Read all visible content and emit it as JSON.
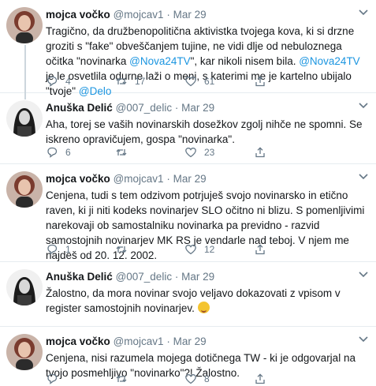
{
  "tweets": [
    {
      "name": "mojca vočko",
      "handle": "@mojcav1",
      "dot": "·",
      "date": "Mar 29",
      "text_parts": [
        "Tragično, da družbenopolitična aktivistka tvojega kova, ki si drzne groziti s \"fake\" obveščanjem tujine, ne vidi dlje od nebuloznega očitka \"novinarka ",
        "@Nova24TV",
        "\", kar nikoli nisem bila. ",
        "@Nova24TV",
        " je le osvetlila odurne laži o meni, s katerimi me je kartelno ubijalo \"tvoje\" ",
        "@Delo"
      ],
      "replies": "4",
      "retweets": "17",
      "likes": "61"
    },
    {
      "name": "Anuška Delić",
      "handle": "@007_delic",
      "dot": "·",
      "date": "Mar 29",
      "text": "Aha, torej se vaših novinarskih dosežkov zgolj nihče ne spomni. Se iskreno opravičujem, gospa \"novinarka\".",
      "replies": "6",
      "retweets": "",
      "likes": "23"
    },
    {
      "name": "mojca vočko",
      "handle": "@mojcav1",
      "dot": "·",
      "date": "Mar 29",
      "text": "Cenjena, tudi s tem odzivom potrjuješ svojo novinarsko in etično raven, ki ji niti kodeks novinarjev SLO očitno ni blizu. S pomenljivimi narekovaji ob samostalniku novinarka pa previdno - razvid samostojnih novinarjev MK RS je vendarle nad teboj. V njem me najdeš od 20. 12. 2002.",
      "replies": "1",
      "retweets": "",
      "likes": "12"
    },
    {
      "name": "Anuška Delić",
      "handle": "@007_delic",
      "dot": "·",
      "date": "Mar 29",
      "text": "Žalostno, da mora novinar svojo veljavo dokazovati z vpisom v register samostojnih novinarjev.",
      "emoji": "hugging-face-emoji"
    },
    {
      "name": "mojca vočko",
      "handle": "@mojcav1",
      "dot": "·",
      "date": "Mar 29",
      "text": "Cenjena, nisi razumela mojega dotičnega TW - ki je odgovarjal na tvojo posmehljivo \"novinarko\"?! Žalostno.",
      "replies": "",
      "retweets": "",
      "likes": "8"
    }
  ],
  "icons": {
    "reply": "reply-icon",
    "retweet": "retweet-icon",
    "like": "heart-icon",
    "share": "share-icon",
    "more": "chevron-down-icon"
  },
  "colors": {
    "link": "#1b95e0",
    "muted": "#657786",
    "divider": "#e6ecf0",
    "thread_line": "#ccd6dd"
  }
}
